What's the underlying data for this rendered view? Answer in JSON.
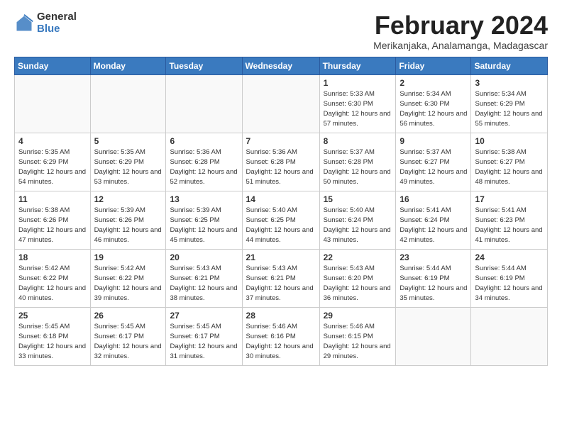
{
  "logo": {
    "general": "General",
    "blue": "Blue"
  },
  "title": "February 2024",
  "subtitle": "Merikanjaka, Analamanga, Madagascar",
  "days_of_week": [
    "Sunday",
    "Monday",
    "Tuesday",
    "Wednesday",
    "Thursday",
    "Friday",
    "Saturday"
  ],
  "weeks": [
    [
      {
        "day": "",
        "info": ""
      },
      {
        "day": "",
        "info": ""
      },
      {
        "day": "",
        "info": ""
      },
      {
        "day": "",
        "info": ""
      },
      {
        "day": "1",
        "sunrise": "5:33 AM",
        "sunset": "6:30 PM",
        "daylight": "12 hours and 57 minutes."
      },
      {
        "day": "2",
        "sunrise": "5:34 AM",
        "sunset": "6:30 PM",
        "daylight": "12 hours and 56 minutes."
      },
      {
        "day": "3",
        "sunrise": "5:34 AM",
        "sunset": "6:29 PM",
        "daylight": "12 hours and 55 minutes."
      }
    ],
    [
      {
        "day": "4",
        "sunrise": "5:35 AM",
        "sunset": "6:29 PM",
        "daylight": "12 hours and 54 minutes."
      },
      {
        "day": "5",
        "sunrise": "5:35 AM",
        "sunset": "6:29 PM",
        "daylight": "12 hours and 53 minutes."
      },
      {
        "day": "6",
        "sunrise": "5:36 AM",
        "sunset": "6:28 PM",
        "daylight": "12 hours and 52 minutes."
      },
      {
        "day": "7",
        "sunrise": "5:36 AM",
        "sunset": "6:28 PM",
        "daylight": "12 hours and 51 minutes."
      },
      {
        "day": "8",
        "sunrise": "5:37 AM",
        "sunset": "6:28 PM",
        "daylight": "12 hours and 50 minutes."
      },
      {
        "day": "9",
        "sunrise": "5:37 AM",
        "sunset": "6:27 PM",
        "daylight": "12 hours and 49 minutes."
      },
      {
        "day": "10",
        "sunrise": "5:38 AM",
        "sunset": "6:27 PM",
        "daylight": "12 hours and 48 minutes."
      }
    ],
    [
      {
        "day": "11",
        "sunrise": "5:38 AM",
        "sunset": "6:26 PM",
        "daylight": "12 hours and 47 minutes."
      },
      {
        "day": "12",
        "sunrise": "5:39 AM",
        "sunset": "6:26 PM",
        "daylight": "12 hours and 46 minutes."
      },
      {
        "day": "13",
        "sunrise": "5:39 AM",
        "sunset": "6:25 PM",
        "daylight": "12 hours and 45 minutes."
      },
      {
        "day": "14",
        "sunrise": "5:40 AM",
        "sunset": "6:25 PM",
        "daylight": "12 hours and 44 minutes."
      },
      {
        "day": "15",
        "sunrise": "5:40 AM",
        "sunset": "6:24 PM",
        "daylight": "12 hours and 43 minutes."
      },
      {
        "day": "16",
        "sunrise": "5:41 AM",
        "sunset": "6:24 PM",
        "daylight": "12 hours and 42 minutes."
      },
      {
        "day": "17",
        "sunrise": "5:41 AM",
        "sunset": "6:23 PM",
        "daylight": "12 hours and 41 minutes."
      }
    ],
    [
      {
        "day": "18",
        "sunrise": "5:42 AM",
        "sunset": "6:22 PM",
        "daylight": "12 hours and 40 minutes."
      },
      {
        "day": "19",
        "sunrise": "5:42 AM",
        "sunset": "6:22 PM",
        "daylight": "12 hours and 39 minutes."
      },
      {
        "day": "20",
        "sunrise": "5:43 AM",
        "sunset": "6:21 PM",
        "daylight": "12 hours and 38 minutes."
      },
      {
        "day": "21",
        "sunrise": "5:43 AM",
        "sunset": "6:21 PM",
        "daylight": "12 hours and 37 minutes."
      },
      {
        "day": "22",
        "sunrise": "5:43 AM",
        "sunset": "6:20 PM",
        "daylight": "12 hours and 36 minutes."
      },
      {
        "day": "23",
        "sunrise": "5:44 AM",
        "sunset": "6:19 PM",
        "daylight": "12 hours and 35 minutes."
      },
      {
        "day": "24",
        "sunrise": "5:44 AM",
        "sunset": "6:19 PM",
        "daylight": "12 hours and 34 minutes."
      }
    ],
    [
      {
        "day": "25",
        "sunrise": "5:45 AM",
        "sunset": "6:18 PM",
        "daylight": "12 hours and 33 minutes."
      },
      {
        "day": "26",
        "sunrise": "5:45 AM",
        "sunset": "6:17 PM",
        "daylight": "12 hours and 32 minutes."
      },
      {
        "day": "27",
        "sunrise": "5:45 AM",
        "sunset": "6:17 PM",
        "daylight": "12 hours and 31 minutes."
      },
      {
        "day": "28",
        "sunrise": "5:46 AM",
        "sunset": "6:16 PM",
        "daylight": "12 hours and 30 minutes."
      },
      {
        "day": "29",
        "sunrise": "5:46 AM",
        "sunset": "6:15 PM",
        "daylight": "12 hours and 29 minutes."
      },
      {
        "day": "",
        "info": ""
      },
      {
        "day": "",
        "info": ""
      }
    ]
  ]
}
